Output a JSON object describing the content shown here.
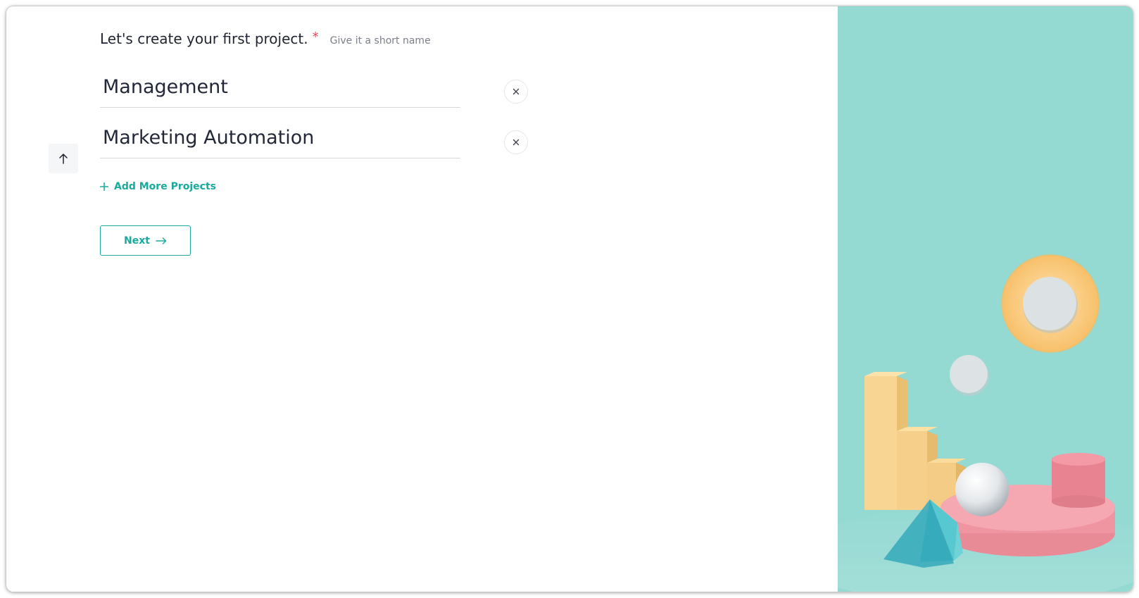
{
  "form": {
    "question": "Let's create your first project.",
    "required_marker": "*",
    "hint": "Give it a short name",
    "projects": [
      {
        "value": "Management"
      },
      {
        "value": "Marketing Automation"
      }
    ],
    "add_more_label": "Add More Projects",
    "next_label": "Next"
  },
  "icons": {
    "remove": "close-icon",
    "side_button": "arrow-up-icon",
    "add_more": "plus-icon",
    "next": "arrow-right-icon"
  },
  "colors": {
    "accent": "#1aa99e",
    "required": "#e0455d",
    "text_primary": "#232838",
    "hint": "#7a7f8a",
    "illustration_bg": "#95d9d3"
  }
}
